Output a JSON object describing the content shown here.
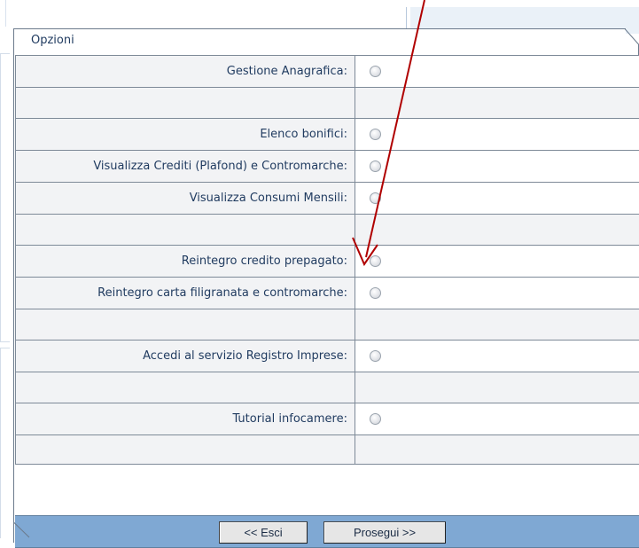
{
  "panel": {
    "title": "Opzioni"
  },
  "rows": [
    {
      "type": "item",
      "label": "Gestione Anagrafica:"
    },
    {
      "type": "spacer"
    },
    {
      "type": "item",
      "label": "Elenco bonifici:"
    },
    {
      "type": "item",
      "label": "Visualizza Crediti (Plafond) e Contromarche:"
    },
    {
      "type": "item",
      "label": "Visualizza Consumi Mensili:"
    },
    {
      "type": "spacer"
    },
    {
      "type": "item",
      "label": "Reintegro credito prepagato:"
    },
    {
      "type": "item",
      "label": "Reintegro carta filigranata e contromarche:"
    },
    {
      "type": "spacer"
    },
    {
      "type": "item",
      "label": "Accedi al servizio Registro Imprese:"
    },
    {
      "type": "spacer"
    },
    {
      "type": "item",
      "label": "Tutorial infocamere:"
    },
    {
      "type": "spacer"
    }
  ],
  "footer": {
    "exit_label": "<< Esci",
    "next_label": "Prosegui >>"
  },
  "annotation": {
    "color": "#b00000",
    "target": "Reintegro credito prepagato:"
  },
  "colors": {
    "footer_bar": "#7fa8d3",
    "label_text": "#1f3a5f",
    "label_bg": "#f2f3f5"
  },
  "icons": {
    "radio": "radio-unselected-icon",
    "arrow": "annotation-arrow-icon"
  }
}
